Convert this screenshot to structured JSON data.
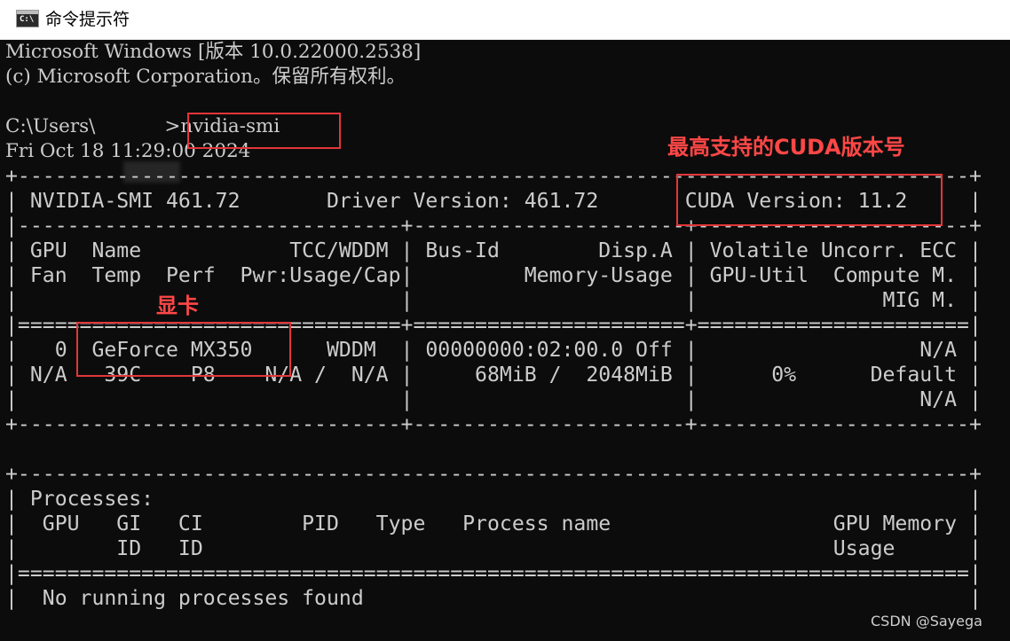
{
  "window": {
    "title": "命令提示符",
    "icon": "cmd-app-icon",
    "icon_glyph": "C:\\"
  },
  "console": {
    "header_line_1": "Microsoft Windows [版本 10.0.22000.2538]",
    "header_line_2": "(c) Microsoft Corporation。保留所有权利。",
    "prompt_prefix": "C:\\Users\\",
    "prompt_suffix": ">",
    "command": "nvidia-smi",
    "timestamp": "Fri Oct 18 11:29:00 2024"
  },
  "smi": {
    "lines": [
      "+-----------------------------------------------------------------------------+",
      "| NVIDIA-SMI 461.72       Driver Version: 461.72       CUDA Version: 11.2     |",
      "|-------------------------------+----------------------+----------------------+",
      "| GPU  Name            TCC/WDDM | Bus-Id        Disp.A | Volatile Uncorr. ECC |",
      "| Fan  Temp  Perf  Pwr:Usage/Cap|         Memory-Usage | GPU-Util  Compute M. |",
      "|                               |                      |               MIG M. |",
      "|===============================+======================+======================|",
      "|   0  GeForce MX350      WDDM  | 00000000:02:00.0 Off |                  N/A |",
      "| N/A   39C    P8    N/A /  N/A |     68MiB /  2048MiB |      0%      Default |",
      "|                               |                      |                  N/A |",
      "+-------------------------------+----------------------+----------------------+",
      "",
      "+-----------------------------------------------------------------------------+",
      "| Processes:                                                                  |",
      "|  GPU   GI   CI        PID   Type   Process name                  GPU Memory |",
      "|        ID   ID                                                   Usage      |",
      "|=============================================================================|",
      "|  No running processes found                                                 |"
    ]
  },
  "annotations": {
    "cuda_label": "最高支持的CUDA版本号",
    "gpu_label": "显卡",
    "highlight_color": "#e3363a"
  },
  "watermark": "CSDN @Sayega"
}
